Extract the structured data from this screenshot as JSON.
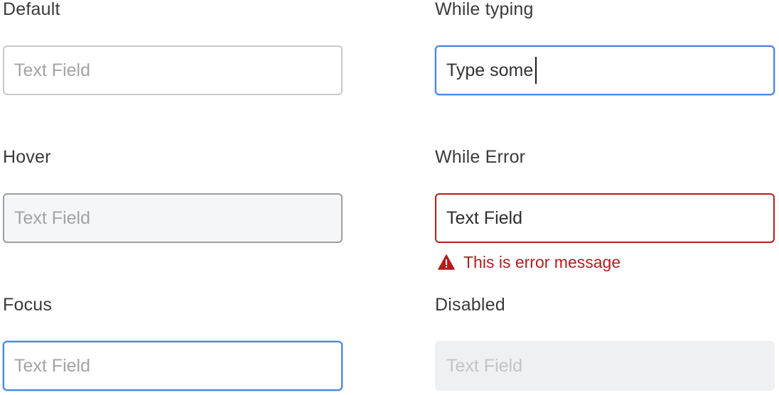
{
  "states": {
    "default": {
      "label": "Default",
      "placeholder": "Text Field"
    },
    "hover": {
      "label": "Hover",
      "placeholder": "Text Field"
    },
    "focus": {
      "label": "Focus",
      "placeholder": "Text Field"
    },
    "typing": {
      "label": "While typing",
      "value": "Type some"
    },
    "error": {
      "label": "While Error",
      "value": "Text Field",
      "message": "This is error message",
      "icon": "warning-icon"
    },
    "disabled": {
      "label": "Disabled",
      "placeholder": "Text Field"
    }
  },
  "colors": {
    "focus_border": "#4a86e8",
    "error": "#b71c1c",
    "hover_background": "#f5f6f7",
    "disabled_background": "#eef0f1"
  }
}
